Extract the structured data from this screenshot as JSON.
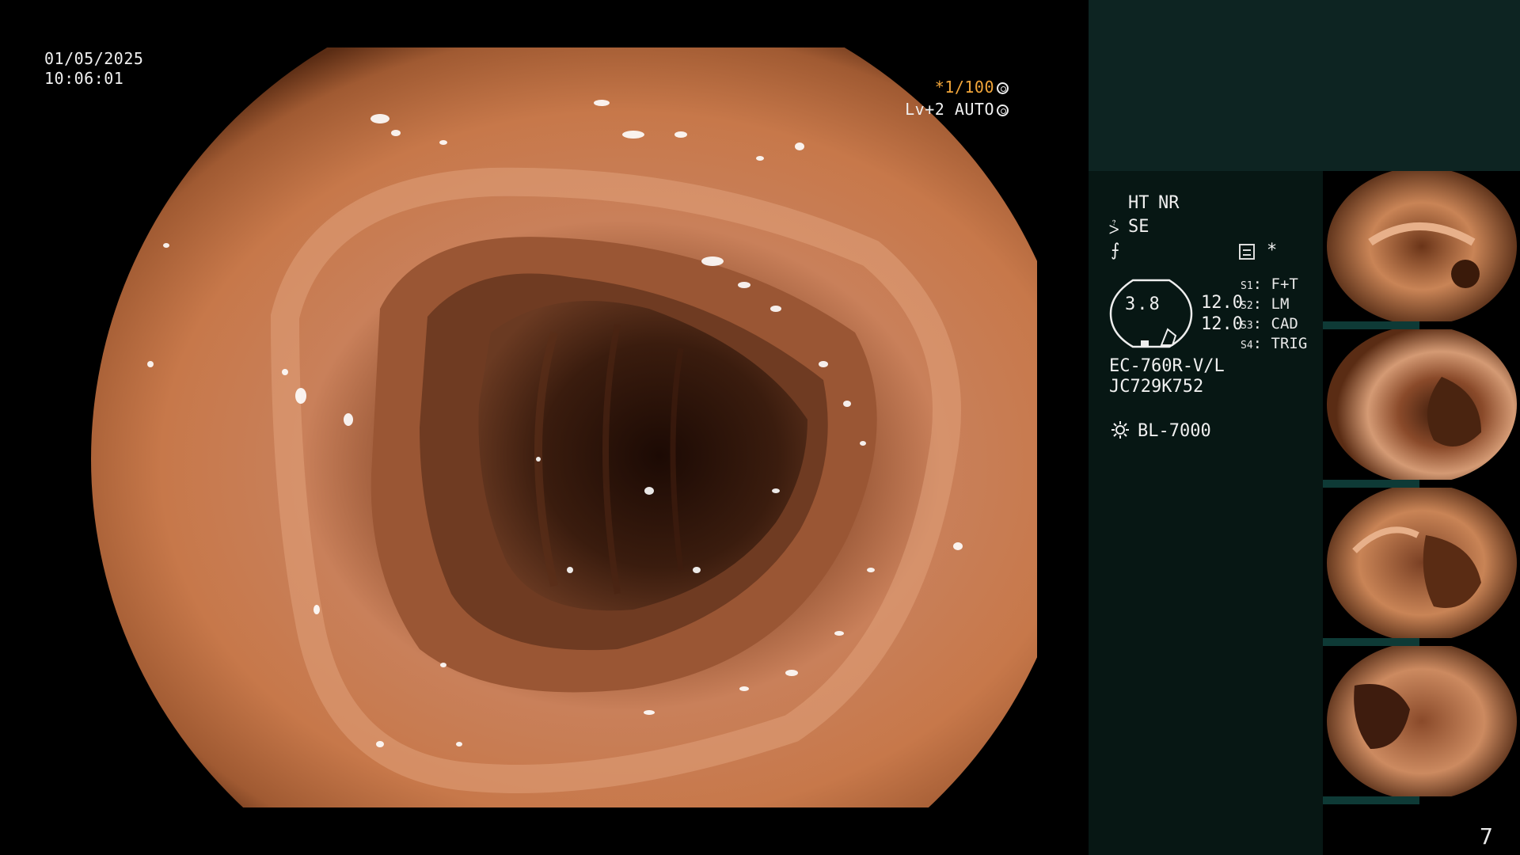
{
  "overlay": {
    "date": "01/05/2025",
    "time": "10:06:01",
    "zoom_prefix": "*1/100",
    "level": "Lv+2 AUTO"
  },
  "panel": {
    "mode_ht": "HT",
    "mode_nr": "NR",
    "mode_se": "SE",
    "star": "*",
    "gauge_value": "3.8",
    "param_a": "12.0",
    "param_b": "12.0",
    "switches": [
      {
        "key": "S1",
        "value": "F+T"
      },
      {
        "key": "S2",
        "value": "LM"
      },
      {
        "key": "S3",
        "value": "CAD"
      },
      {
        "key": "S4",
        "value": "TRIG"
      }
    ],
    "scope_model": "EC-760R-V/L",
    "serial": "JC729K752",
    "light_source": "BL-7000"
  },
  "thumbnails": [
    {
      "id": "thumb-1",
      "serial": "JC729K752"
    },
    {
      "id": "thumb-2",
      "serial": "JC729K752"
    },
    {
      "id": "thumb-3",
      "serial": "JC729K752"
    },
    {
      "id": "thumb-4",
      "serial": "JC729K752"
    }
  ],
  "page_number": "7",
  "colors": {
    "amber": "#f2a63a",
    "panel_top": "#0d2422",
    "panel": "#071714",
    "mucosa": "#c9805a"
  }
}
